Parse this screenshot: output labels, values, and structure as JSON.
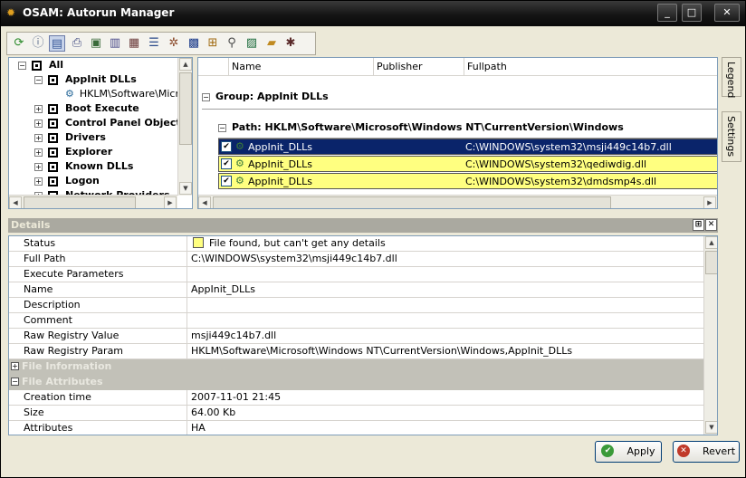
{
  "window": {
    "title": "OSAM: Autorun Manager",
    "minimize": "_",
    "maximize": "□",
    "close": "✕"
  },
  "toolbar": {
    "icons": [
      "refresh-icon",
      "info-icon",
      "file-icon",
      "print-icon",
      "properties-icon",
      "document-icon",
      "report-icon",
      "list-icon",
      "settings-gear-icon",
      "save-icon",
      "tree-icon",
      "search-icon",
      "save-as-icon",
      "folder-icon",
      "gear-icon"
    ]
  },
  "tree": {
    "root": "All",
    "items": [
      {
        "label": "AppInit DLLs",
        "expanded": true
      },
      {
        "label": "HKLM\\Software\\Microsoft\\Windows NT\\CurrentVersion\\Windows",
        "child": true
      },
      {
        "label": "Boot Execute"
      },
      {
        "label": "Control Panel Objects"
      },
      {
        "label": "Drivers"
      },
      {
        "label": "Explorer"
      },
      {
        "label": "Known DLLs"
      },
      {
        "label": "Logon"
      },
      {
        "label": "Network Providers"
      }
    ]
  },
  "list": {
    "columns": [
      "Name",
      "Publisher",
      "Fullpath"
    ],
    "group": "Group: AppInit DLLs",
    "path": "Path: HKLM\\Software\\Microsoft\\Windows NT\\CurrentVersion\\Windows",
    "rows": [
      {
        "name": "AppInit_DLLs",
        "publisher": "",
        "fullpath": "C:\\WINDOWS\\system32\\msji449c14b7.dll",
        "selected": true
      },
      {
        "name": "AppInit_DLLs",
        "publisher": "",
        "fullpath": "C:\\WINDOWS\\system32\\qediwdig.dll"
      },
      {
        "name": "AppInit_DLLs",
        "publisher": "",
        "fullpath": "C:\\WINDOWS\\system32\\dmdsmp4s.dll"
      }
    ]
  },
  "sidetabs": [
    "Legend",
    "Settings"
  ],
  "details": {
    "title": "Details",
    "pin": "⊞",
    "close": "✕",
    "rows": [
      {
        "name": "Status",
        "value": "File found, but can't get any details"
      },
      {
        "name": "Full Path",
        "value": "C:\\WINDOWS\\system32\\msji449c14b7.dll"
      },
      {
        "name": "Execute Parameters",
        "value": ""
      },
      {
        "name": "Name",
        "value": "AppInit_DLLs"
      },
      {
        "name": "Description",
        "value": ""
      },
      {
        "name": "Comment",
        "value": ""
      },
      {
        "name": "Raw Registry Value",
        "value": "msji449c14b7.dll"
      },
      {
        "name": "Raw Registry Param",
        "value": "HKLM\\Software\\Microsoft\\Windows NT\\CurrentVersion\\Windows,AppInit_DLLs"
      }
    ],
    "cat_file_info": "File Information",
    "cat_file_attr": "File Attributes",
    "attr_rows": [
      {
        "name": "Creation time",
        "value": "2007-11-01 21:45"
      },
      {
        "name": "Size",
        "value": "64.00 Kb"
      },
      {
        "name": "Attributes",
        "value": "HA"
      }
    ]
  },
  "buttons": {
    "apply": "Apply",
    "revert": "Revert"
  },
  "colors": {
    "status_warning": "#ffff80",
    "selection": "#0a246a"
  }
}
